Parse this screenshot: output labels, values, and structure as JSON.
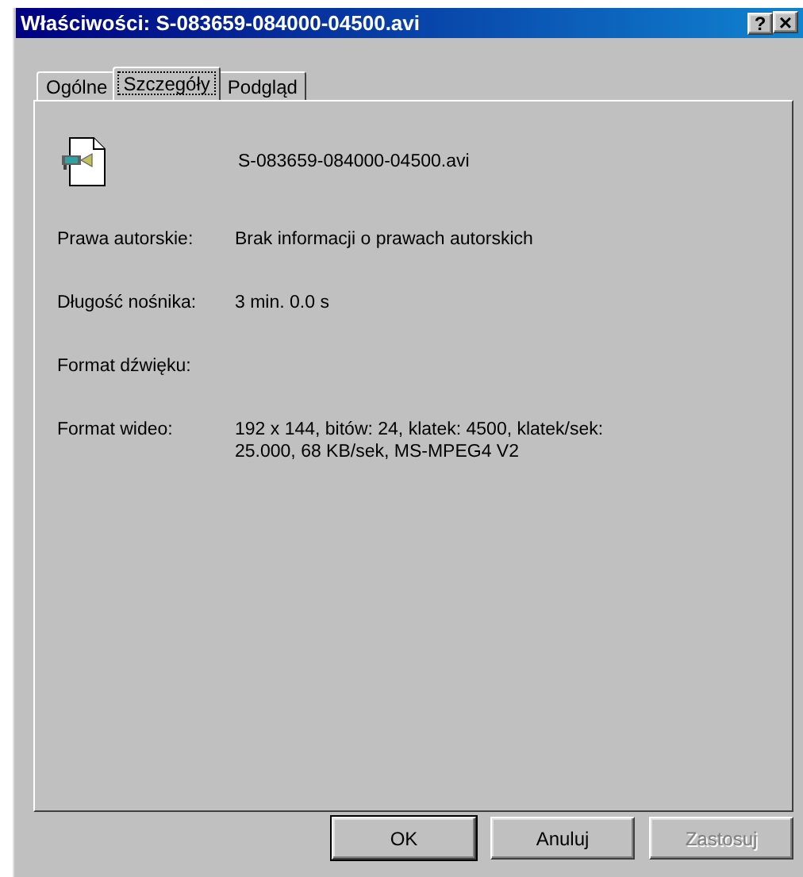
{
  "window": {
    "title": "Właściwości: S-083659-084000-04500.avi",
    "title_buttons": [
      {
        "kind": "help",
        "label": "?"
      },
      {
        "kind": "close",
        "label": "×"
      }
    ]
  },
  "tabs": [
    {
      "label": "Ogólne",
      "selected": false
    },
    {
      "label": "Szczegóły",
      "selected": true
    },
    {
      "label": "Podgląd",
      "selected": false
    }
  ],
  "file": {
    "name": "S-083659-084000-04500.avi"
  },
  "properties": [
    {
      "label": "Prawa autorskie:",
      "value": "Brak informacji o prawach autorskich"
    },
    {
      "label": "Długość nośnika:",
      "value": "3 min. 0.0 s"
    },
    {
      "label": "Format dźwięku:"
    },
    {
      "label": "Format wideo:",
      "value": "192 x 144, bitów: 24, klatek: 4500, klatek/sek: 25.000, 68 KB/sek, MS-MPEG4 V2"
    }
  ],
  "buttons": [
    {
      "label": "OK",
      "default": true,
      "disabled": false
    },
    {
      "label": "Anuluj",
      "default": false,
      "disabled": false
    },
    {
      "label": "Zastosuj",
      "default": false,
      "disabled": true
    }
  ]
}
